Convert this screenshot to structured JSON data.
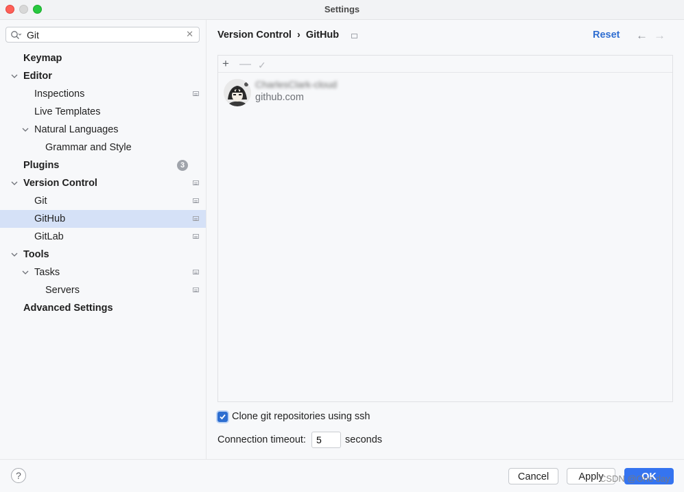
{
  "window": {
    "title": "Settings"
  },
  "search": {
    "value": "Git",
    "placeholder": ""
  },
  "tree": [
    {
      "label": "Keymap"
    },
    {
      "label": "Editor"
    },
    {
      "label": "Inspections"
    },
    {
      "label": "Live Templates"
    },
    {
      "label": "Natural Languages"
    },
    {
      "label": "Grammar and Style"
    },
    {
      "label": "Plugins",
      "badge": "3"
    },
    {
      "label": "Version Control"
    },
    {
      "label": "Git"
    },
    {
      "label": "GitHub"
    },
    {
      "label": "GitLab"
    },
    {
      "label": "Tools"
    },
    {
      "label": "Tasks"
    },
    {
      "label": "Servers"
    },
    {
      "label": "Advanced Settings"
    }
  ],
  "breadcrumb": {
    "parent": "Version Control",
    "separator": "›",
    "current": "GitHub"
  },
  "header": {
    "reset_label": "Reset"
  },
  "account": {
    "name": "CharlesClark-cloud",
    "host": "github.com"
  },
  "options": {
    "clone_ssh_label": "Clone git repositories using ssh",
    "clone_ssh_checked": true,
    "timeout_label": "Connection timeout:",
    "timeout_value": "5",
    "timeout_unit": "seconds"
  },
  "footer": {
    "help_label": "?",
    "cancel_label": "Cancel",
    "apply_label": "Apply",
    "ok_label": "OK"
  },
  "watermark": "CSDN @One day​",
  "colors": {
    "accent": "#3574f0",
    "selection": "#d5e1f7",
    "link": "#2f6ed1"
  }
}
